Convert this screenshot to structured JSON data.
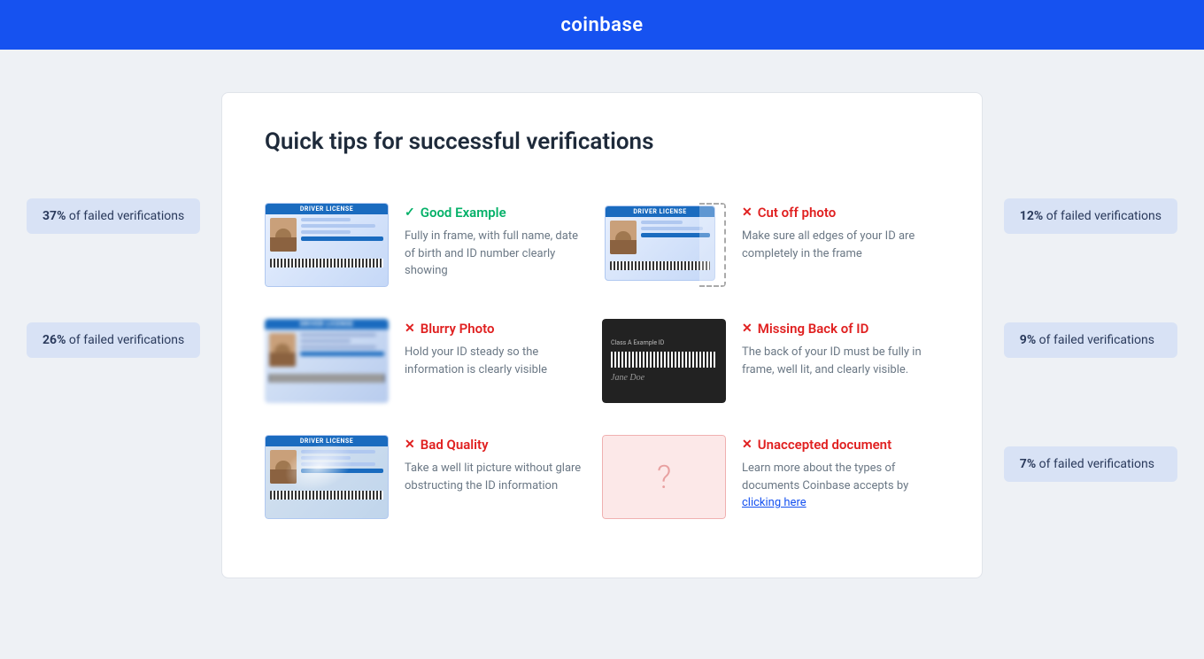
{
  "header": {
    "logo": "coinbase"
  },
  "sidebar_left": {
    "stats": [
      {
        "value": "37%",
        "label": "of failed verifications"
      },
      {
        "value": "26%",
        "label": "of failed verifications"
      }
    ]
  },
  "sidebar_right": {
    "stats": [
      {
        "value": "12%",
        "label": "of failed verifications"
      },
      {
        "value": "9%",
        "label": "of failed verifications"
      },
      {
        "value": "7%",
        "label": "of failed verifications"
      }
    ]
  },
  "card": {
    "title": "Quick tips for successful verifications",
    "tips": [
      {
        "id": "good-example",
        "status": "good",
        "icon": "✓",
        "label": "Good Example",
        "description": "Fully in frame, with full name, date of birth and ID number clearly showing",
        "image_type": "id-good"
      },
      {
        "id": "cut-off-photo",
        "status": "bad",
        "icon": "✕",
        "label": "Cut off photo",
        "description": "Make sure all edges of your ID are completely in the frame",
        "image_type": "id-cutoff"
      },
      {
        "id": "blurry-photo",
        "status": "bad",
        "icon": "✕",
        "label": "Blurry Photo",
        "description": "Hold your ID steady so the information is clearly visible",
        "image_type": "id-blurry"
      },
      {
        "id": "missing-back",
        "status": "bad",
        "icon": "✕",
        "label": "Missing Back of ID",
        "description": "The back of your ID must be fully in frame, well lit, and clearly visible.",
        "image_type": "id-back"
      },
      {
        "id": "bad-quality",
        "status": "bad",
        "icon": "✕",
        "label": "Bad Quality",
        "description": "Take a well lit picture without glare obstructing the ID information",
        "image_type": "id-badquality"
      },
      {
        "id": "unaccepted-document",
        "status": "bad",
        "icon": "✕",
        "label": "Unaccepted document",
        "description": "Learn more about the types of documents Coinbase accepts by",
        "link_text": "clicking here",
        "image_type": "id-unaccepted"
      }
    ]
  }
}
